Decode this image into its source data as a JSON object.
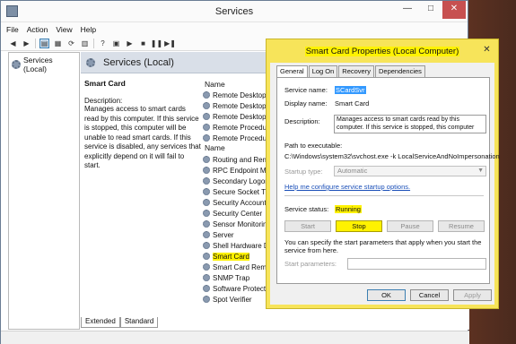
{
  "services_window": {
    "title": "Services",
    "controls": {
      "minimize": "—",
      "maximize": "□",
      "close": "✕"
    },
    "menu": [
      "File",
      "Action",
      "View",
      "Help"
    ],
    "tree": {
      "item": "Services (Local)"
    },
    "main": {
      "header": "Services (Local)",
      "selected_name": "Smart Card",
      "description_label": "Description:",
      "description_text": "Manages access to smart cards read by this computer. If this service is stopped, this computer will be unable to read smart cards. If this service is disabled, any services that explicitly depend on it will fail to start.",
      "column_header": "Name",
      "column_header_repeat": "Name",
      "services_top": [
        "Remote Desktop",
        "Remote Desktop",
        "Remote Desktop",
        "Remote Procedur",
        "Remote Procedur"
      ],
      "services_bottom": [
        "Routing and Rem",
        "RPC Endpoint Ma",
        "Secondary Logon",
        "Secure Socket Tu",
        "Security Account",
        "Security Center",
        "Sensor Monitorin",
        "Server",
        "Shell Hardware D",
        "Smart Card",
        "Smart Card Remo",
        "SNMP Trap",
        "Software Protecti",
        "Spot Verifier"
      ],
      "highlighted_service": "Smart Card"
    },
    "tabs": [
      "Extended",
      "Standard"
    ]
  },
  "dialog": {
    "title": "Smart Card Properties (Local Computer)",
    "close": "✕",
    "tabs": [
      "General",
      "Log On",
      "Recovery",
      "Dependencies"
    ],
    "active_tab": "General",
    "service_name_label": "Service name:",
    "service_name": "SCardSvr",
    "display_name_label": "Display name:",
    "display_name": "Smart Card",
    "description_label": "Description:",
    "description": "Manages access to smart cards read by this computer. If this service is stopped, this computer",
    "path_label": "Path to executable:",
    "path": "C:\\Windows\\system32\\svchost.exe -k LocalServiceAndNoImpersonation",
    "startup_label": "Startup type:",
    "startup_value": "Automatic",
    "help_link": "Help me configure service startup options.",
    "status_label": "Service status:",
    "status_value": "Running",
    "buttons": {
      "start": "Start",
      "stop": "Stop",
      "pause": "Pause",
      "resume": "Resume"
    },
    "hint": "You can specify the start parameters that apply when you start the service from here.",
    "params_label": "Start parameters:",
    "params_value": "",
    "footer": {
      "ok": "OK",
      "cancel": "Cancel",
      "apply": "Apply"
    }
  },
  "colors": {
    "highlight": "#fff200",
    "dialog_frame": "#f7e45a",
    "header_band": "#d9dfe8"
  }
}
